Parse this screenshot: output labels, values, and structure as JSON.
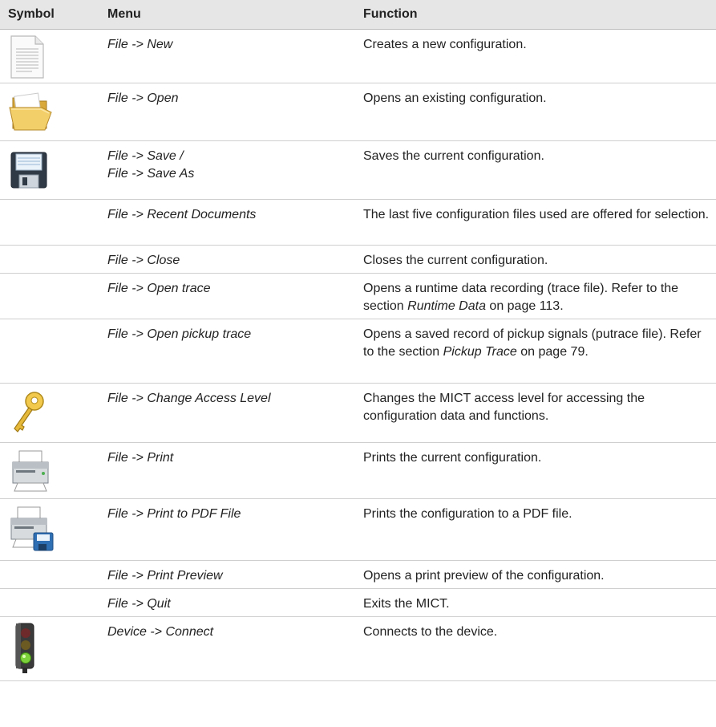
{
  "header": {
    "symbol": "Symbol",
    "menu": "Menu",
    "function": "Function"
  },
  "rows": [
    {
      "icon": "new-document-icon",
      "menu": [
        "File -> New"
      ],
      "function": "Creates a new configuration."
    },
    {
      "icon": "open-folder-icon",
      "menu": [
        "File -> Open"
      ],
      "function": "Opens an existing configuration."
    },
    {
      "icon": "floppy-disk-icon",
      "menu": [
        "File -> Save /",
        "File -> Save As"
      ],
      "function": "Saves the current configuration."
    },
    {
      "icon": "",
      "menu": [
        "File -> Recent Documents"
      ],
      "function": "The last five configuration files used are offered for selection."
    },
    {
      "icon": "",
      "menu": [
        "File -> Close"
      ],
      "function": "Closes the current configuration."
    },
    {
      "icon": "",
      "menu": [
        "File -> Open trace"
      ],
      "function_parts": [
        "Opens a runtime data recording (trace file). Refer to the section ",
        "Runtime Data",
        " on page 113."
      ]
    },
    {
      "icon": "",
      "menu": [
        "File -> Open pickup trace"
      ],
      "function_parts": [
        "Opens a saved record of pickup signals (putrace file). Refer to the section ",
        "Pickup Trace",
        " on page 79."
      ]
    },
    {
      "icon": "key-icon",
      "menu": [
        "File -> Change Access Level"
      ],
      "function": "Changes the MICT access level for accessing the configuration data and functions."
    },
    {
      "icon": "printer-icon",
      "menu": [
        "File -> Print"
      ],
      "function": "Prints the current configuration."
    },
    {
      "icon": "printer-pdf-icon",
      "menu": [
        "File -> Print to PDF File"
      ],
      "function": "Prints the configuration to a PDF file."
    },
    {
      "icon": "",
      "menu": [
        "File -> Print Preview"
      ],
      "function": "Opens a print preview of the configuration."
    },
    {
      "icon": "",
      "menu": [
        "File -> Quit"
      ],
      "function": "Exits the MICT."
    },
    {
      "icon": "traffic-light-icon",
      "menu": [
        "Device -> Connect"
      ],
      "function": "Connects to the device."
    }
  ]
}
